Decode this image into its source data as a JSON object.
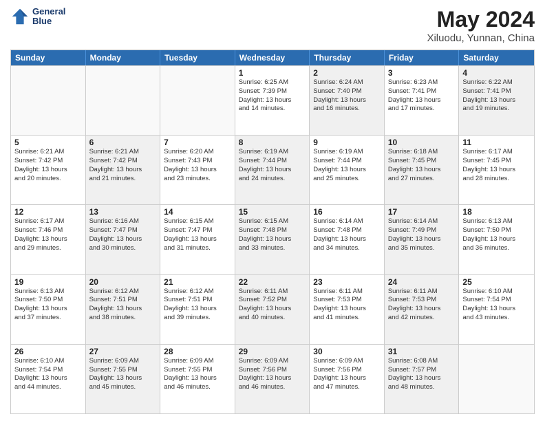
{
  "header": {
    "logo_line1": "General",
    "logo_line2": "Blue",
    "title": "May 2024",
    "subtitle": "Xiluodu, Yunnan, China"
  },
  "weekdays": [
    "Sunday",
    "Monday",
    "Tuesday",
    "Wednesday",
    "Thursday",
    "Friday",
    "Saturday"
  ],
  "rows": [
    [
      {
        "day": "",
        "text": "",
        "shaded": false,
        "empty": true
      },
      {
        "day": "",
        "text": "",
        "shaded": false,
        "empty": true
      },
      {
        "day": "",
        "text": "",
        "shaded": false,
        "empty": true
      },
      {
        "day": "1",
        "text": "Sunrise: 6:25 AM\nSunset: 7:39 PM\nDaylight: 13 hours\nand 14 minutes.",
        "shaded": false,
        "empty": false
      },
      {
        "day": "2",
        "text": "Sunrise: 6:24 AM\nSunset: 7:40 PM\nDaylight: 13 hours\nand 16 minutes.",
        "shaded": true,
        "empty": false
      },
      {
        "day": "3",
        "text": "Sunrise: 6:23 AM\nSunset: 7:41 PM\nDaylight: 13 hours\nand 17 minutes.",
        "shaded": false,
        "empty": false
      },
      {
        "day": "4",
        "text": "Sunrise: 6:22 AM\nSunset: 7:41 PM\nDaylight: 13 hours\nand 19 minutes.",
        "shaded": true,
        "empty": false
      }
    ],
    [
      {
        "day": "5",
        "text": "Sunrise: 6:21 AM\nSunset: 7:42 PM\nDaylight: 13 hours\nand 20 minutes.",
        "shaded": false,
        "empty": false
      },
      {
        "day": "6",
        "text": "Sunrise: 6:21 AM\nSunset: 7:42 PM\nDaylight: 13 hours\nand 21 minutes.",
        "shaded": true,
        "empty": false
      },
      {
        "day": "7",
        "text": "Sunrise: 6:20 AM\nSunset: 7:43 PM\nDaylight: 13 hours\nand 23 minutes.",
        "shaded": false,
        "empty": false
      },
      {
        "day": "8",
        "text": "Sunrise: 6:19 AM\nSunset: 7:44 PM\nDaylight: 13 hours\nand 24 minutes.",
        "shaded": true,
        "empty": false
      },
      {
        "day": "9",
        "text": "Sunrise: 6:19 AM\nSunset: 7:44 PM\nDaylight: 13 hours\nand 25 minutes.",
        "shaded": false,
        "empty": false
      },
      {
        "day": "10",
        "text": "Sunrise: 6:18 AM\nSunset: 7:45 PM\nDaylight: 13 hours\nand 27 minutes.",
        "shaded": true,
        "empty": false
      },
      {
        "day": "11",
        "text": "Sunrise: 6:17 AM\nSunset: 7:45 PM\nDaylight: 13 hours\nand 28 minutes.",
        "shaded": false,
        "empty": false
      }
    ],
    [
      {
        "day": "12",
        "text": "Sunrise: 6:17 AM\nSunset: 7:46 PM\nDaylight: 13 hours\nand 29 minutes.",
        "shaded": false,
        "empty": false
      },
      {
        "day": "13",
        "text": "Sunrise: 6:16 AM\nSunset: 7:47 PM\nDaylight: 13 hours\nand 30 minutes.",
        "shaded": true,
        "empty": false
      },
      {
        "day": "14",
        "text": "Sunrise: 6:15 AM\nSunset: 7:47 PM\nDaylight: 13 hours\nand 31 minutes.",
        "shaded": false,
        "empty": false
      },
      {
        "day": "15",
        "text": "Sunrise: 6:15 AM\nSunset: 7:48 PM\nDaylight: 13 hours\nand 33 minutes.",
        "shaded": true,
        "empty": false
      },
      {
        "day": "16",
        "text": "Sunrise: 6:14 AM\nSunset: 7:48 PM\nDaylight: 13 hours\nand 34 minutes.",
        "shaded": false,
        "empty": false
      },
      {
        "day": "17",
        "text": "Sunrise: 6:14 AM\nSunset: 7:49 PM\nDaylight: 13 hours\nand 35 minutes.",
        "shaded": true,
        "empty": false
      },
      {
        "day": "18",
        "text": "Sunrise: 6:13 AM\nSunset: 7:50 PM\nDaylight: 13 hours\nand 36 minutes.",
        "shaded": false,
        "empty": false
      }
    ],
    [
      {
        "day": "19",
        "text": "Sunrise: 6:13 AM\nSunset: 7:50 PM\nDaylight: 13 hours\nand 37 minutes.",
        "shaded": false,
        "empty": false
      },
      {
        "day": "20",
        "text": "Sunrise: 6:12 AM\nSunset: 7:51 PM\nDaylight: 13 hours\nand 38 minutes.",
        "shaded": true,
        "empty": false
      },
      {
        "day": "21",
        "text": "Sunrise: 6:12 AM\nSunset: 7:51 PM\nDaylight: 13 hours\nand 39 minutes.",
        "shaded": false,
        "empty": false
      },
      {
        "day": "22",
        "text": "Sunrise: 6:11 AM\nSunset: 7:52 PM\nDaylight: 13 hours\nand 40 minutes.",
        "shaded": true,
        "empty": false
      },
      {
        "day": "23",
        "text": "Sunrise: 6:11 AM\nSunset: 7:53 PM\nDaylight: 13 hours\nand 41 minutes.",
        "shaded": false,
        "empty": false
      },
      {
        "day": "24",
        "text": "Sunrise: 6:11 AM\nSunset: 7:53 PM\nDaylight: 13 hours\nand 42 minutes.",
        "shaded": true,
        "empty": false
      },
      {
        "day": "25",
        "text": "Sunrise: 6:10 AM\nSunset: 7:54 PM\nDaylight: 13 hours\nand 43 minutes.",
        "shaded": false,
        "empty": false
      }
    ],
    [
      {
        "day": "26",
        "text": "Sunrise: 6:10 AM\nSunset: 7:54 PM\nDaylight: 13 hours\nand 44 minutes.",
        "shaded": false,
        "empty": false
      },
      {
        "day": "27",
        "text": "Sunrise: 6:09 AM\nSunset: 7:55 PM\nDaylight: 13 hours\nand 45 minutes.",
        "shaded": true,
        "empty": false
      },
      {
        "day": "28",
        "text": "Sunrise: 6:09 AM\nSunset: 7:55 PM\nDaylight: 13 hours\nand 46 minutes.",
        "shaded": false,
        "empty": false
      },
      {
        "day": "29",
        "text": "Sunrise: 6:09 AM\nSunset: 7:56 PM\nDaylight: 13 hours\nand 46 minutes.",
        "shaded": true,
        "empty": false
      },
      {
        "day": "30",
        "text": "Sunrise: 6:09 AM\nSunset: 7:56 PM\nDaylight: 13 hours\nand 47 minutes.",
        "shaded": false,
        "empty": false
      },
      {
        "day": "31",
        "text": "Sunrise: 6:08 AM\nSunset: 7:57 PM\nDaylight: 13 hours\nand 48 minutes.",
        "shaded": true,
        "empty": false
      },
      {
        "day": "",
        "text": "",
        "shaded": false,
        "empty": true
      }
    ]
  ]
}
